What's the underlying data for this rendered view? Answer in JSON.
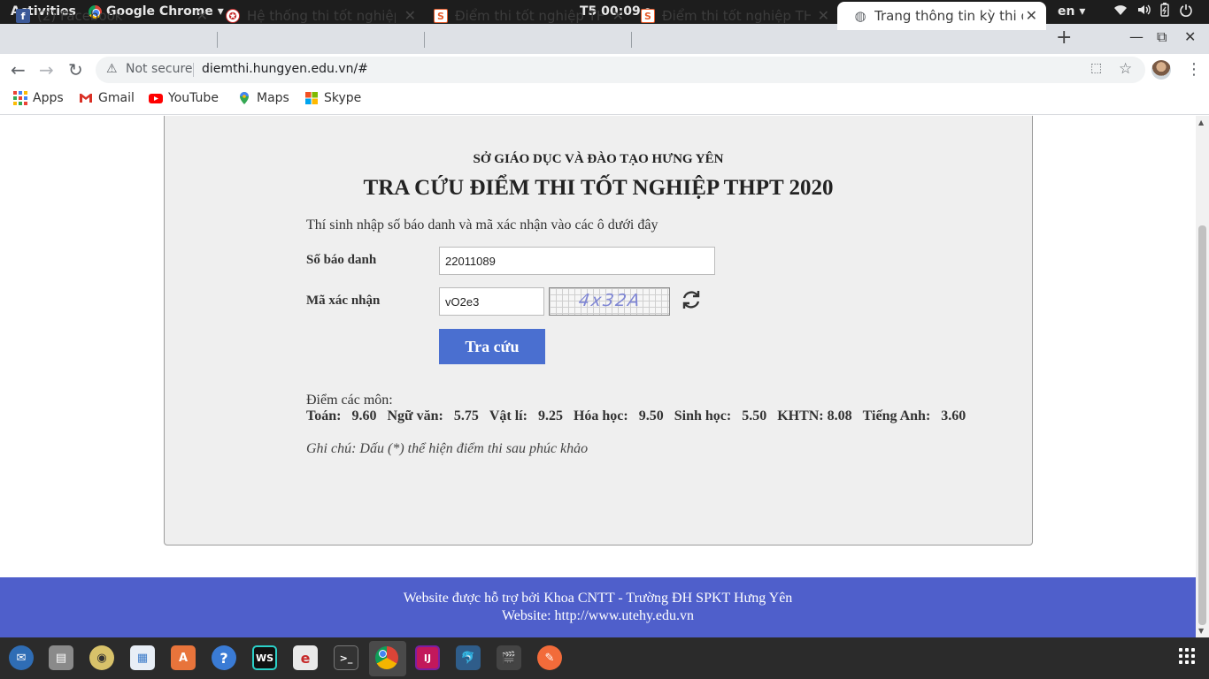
{
  "system_bar": {
    "activities": "Activities",
    "app_name": "Google Chrome",
    "app_menu_arrow": "▾",
    "clock": "T5 00:09",
    "clock_dot": "●",
    "language": "en ▾",
    "tray_icons": [
      "wifi-icon",
      "volume-icon",
      "battery-icon",
      "power-menu-icon"
    ]
  },
  "tabs": [
    {
      "label": "(2) Facebook",
      "icon": "facebook-icon",
      "icon_text": "f",
      "icon_color": "#3b5998"
    },
    {
      "label": "Hệ thống thi tốt nghiệp",
      "icon": "emblem-icon",
      "icon_text": "✪",
      "icon_color": "#c62828"
    },
    {
      "label": "Điểm thi tốt nghiệp THPT",
      "icon": "s-logo-icon",
      "icon_text": "S",
      "icon_color": "#e65c2c"
    },
    {
      "label": "Điểm thi tốt nghiệp THPT",
      "icon": "s-logo-icon",
      "icon_text": "S",
      "icon_color": "#e65c2c"
    },
    {
      "label": "Trang thông tin kỳ thi quốc gia",
      "icon": "globe-icon",
      "icon_text": "◍",
      "icon_color": "#5f6368",
      "active": true
    }
  ],
  "tab_close": "✕",
  "new_tab": "+",
  "window_controls": {
    "minimize": "—",
    "maximize": "⧉",
    "close": "✕"
  },
  "navigation": {
    "back": "←",
    "forward": "→",
    "reload": "↻",
    "security_icon": "⚠",
    "security_text": "Not secure",
    "url": "diemthi.hungyen.edu.vn/#",
    "translate": "⬚",
    "bookmark_star": "☆",
    "menu": "⋮"
  },
  "bookmarks": [
    {
      "label": "Apps",
      "icon": "apps-grid-icon"
    },
    {
      "label": "Gmail",
      "icon": "gmail-icon"
    },
    {
      "label": "YouTube",
      "icon": "youtube-icon"
    },
    {
      "label": "Maps",
      "icon": "maps-pin-icon"
    },
    {
      "label": "Skype",
      "icon": "skype-icon"
    }
  ],
  "page": {
    "organization": "SỞ GIÁO DỤC VÀ ĐÀO TẠO HƯNG YÊN",
    "title": "TRA CỨU ĐIỂM THI TỐT NGHIỆP THPT 2020",
    "instruction": "Thí sinh nhập số báo danh và mã xác nhận vào các ô dưới đây",
    "candidate_id": {
      "label": "Số báo danh",
      "value": "22011089"
    },
    "captcha": {
      "label": "Mã xác nhận",
      "value": "vO2e3",
      "image_text": "4x32A"
    },
    "submit_label": "Tra cứu",
    "scores_heading": "Điểm các môn:",
    "scores": [
      {
        "subject": "Toán:",
        "score": "9.60"
      },
      {
        "subject": "Ngữ văn:",
        "score": "5.75"
      },
      {
        "subject": "Vật lí:",
        "score": "9.25"
      },
      {
        "subject": "Hóa học:",
        "score": "9.50"
      },
      {
        "subject": "Sinh học:",
        "score": "5.50"
      },
      {
        "subject": "KHTN:",
        "score": "8.08"
      },
      {
        "subject": "Tiếng Anh:",
        "score": "3.60"
      }
    ],
    "note": "Ghi chú: Dấu (*) thể hiện điểm thi sau phúc khảo"
  },
  "footer": {
    "line1": "Website được hỗ trợ bởi Khoa CNTT - Trường ĐH SPKT Hưng Yên",
    "line2": "Website: http://www.utehy.edu.vn"
  },
  "dock": [
    {
      "name": "thunderbird-icon",
      "glyph": "✉",
      "color": "#2f6db5"
    },
    {
      "name": "files-icon",
      "glyph": "▤",
      "color": "#8a8a8a"
    },
    {
      "name": "rhythmbox-icon",
      "glyph": "◉",
      "color": "#d8c26a"
    },
    {
      "name": "writer-icon",
      "glyph": "▦",
      "color": "#3d7cc9"
    },
    {
      "name": "software-center-icon",
      "glyph": "A",
      "color": "#e8743b"
    },
    {
      "name": "help-icon",
      "glyph": "?",
      "color": "#3a7bd5"
    },
    {
      "name": "webstorm-icon",
      "glyph": "WS",
      "color": "#111111"
    },
    {
      "name": "foxit-icon",
      "glyph": "e",
      "color": "#e9e9e9"
    },
    {
      "name": "terminal-icon",
      "glyph": ">_",
      "color": "#333333"
    },
    {
      "name": "chrome-icon",
      "glyph": "",
      "color": "#ffffff"
    },
    {
      "name": "intellij-icon",
      "glyph": "IJ",
      "color": "#c2185b"
    },
    {
      "name": "mysql-workbench-icon",
      "glyph": "🐬",
      "color": "#2f5d8a"
    },
    {
      "name": "video-editor-icon",
      "glyph": "🎬",
      "color": "#444444"
    },
    {
      "name": "sketch-icon",
      "glyph": "✎",
      "color": "#f26b3a"
    }
  ]
}
